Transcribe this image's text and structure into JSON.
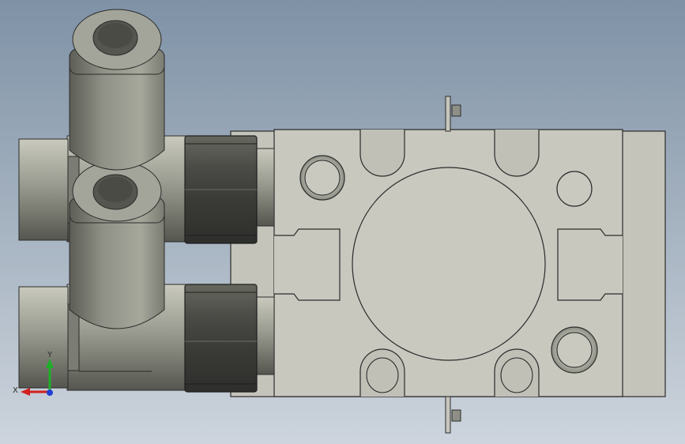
{
  "view": {
    "background_top": "#7f92a6",
    "background_bottom": "#cdd4dd"
  },
  "colors": {
    "body_face": "#c6c6bd",
    "body_edge": "#2a2a2a",
    "fitting_dark": "#3f4140",
    "fitting_mid": "#8d8e84",
    "fitting_light": "#c1c2b6",
    "axis_x": "#d21f1f",
    "axis_y": "#1fae2a",
    "axis_z": "#1f3fd2"
  },
  "triad": {
    "x_label": "X",
    "y_label": "Y",
    "icon": "axis-triad-icon"
  }
}
